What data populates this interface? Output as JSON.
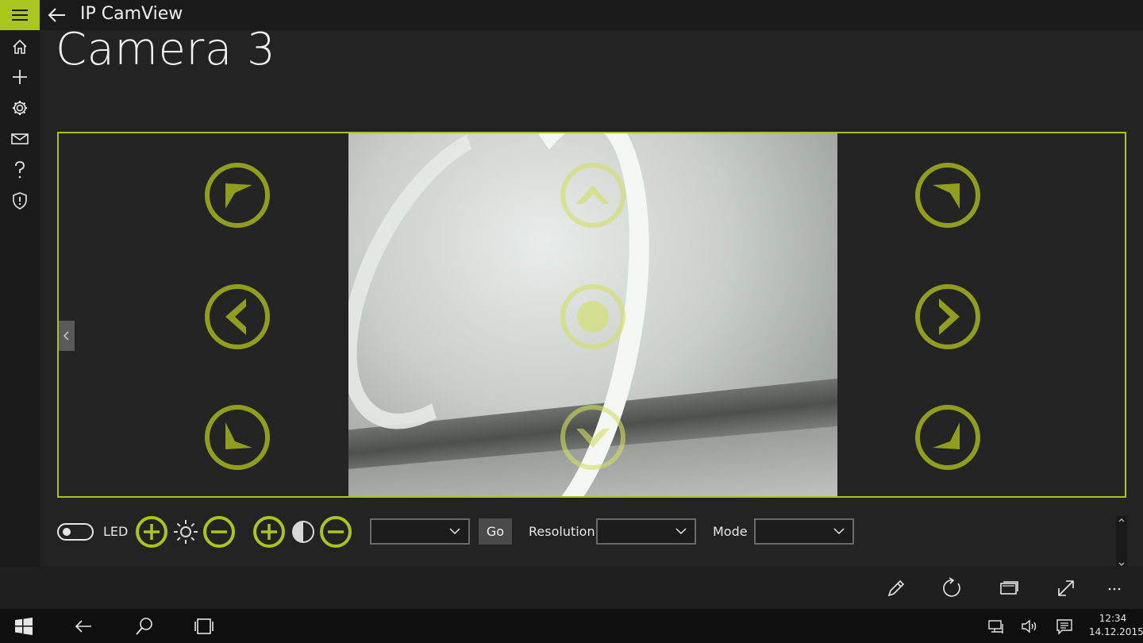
{
  "app": {
    "title": "IP CamView"
  },
  "page": {
    "title": "Camera 3"
  },
  "nav": {
    "items": [
      {
        "name": "home",
        "icon": "home-icon"
      },
      {
        "name": "add",
        "icon": "plus-icon"
      },
      {
        "name": "settings",
        "icon": "gear-icon"
      },
      {
        "name": "mail",
        "icon": "mail-icon"
      },
      {
        "name": "help",
        "icon": "question-icon"
      },
      {
        "name": "privacy",
        "icon": "shield-icon"
      }
    ]
  },
  "controls": {
    "led_label": "LED",
    "led_on": false,
    "go_label": "Go",
    "resolution_label": "Resolution",
    "mode_label": "Mode",
    "preset_value": "",
    "resolution_value": "",
    "mode_value": ""
  },
  "appbar": {
    "items": [
      "edit-icon",
      "refresh-icon",
      "snapshot-icon",
      "fullscreen-icon",
      "more-icon"
    ]
  },
  "taskbar": {
    "time": "12:34",
    "date": "14.12.2015"
  },
  "colors": {
    "accent": "#a9c520",
    "ptz": "#b5c51d"
  }
}
